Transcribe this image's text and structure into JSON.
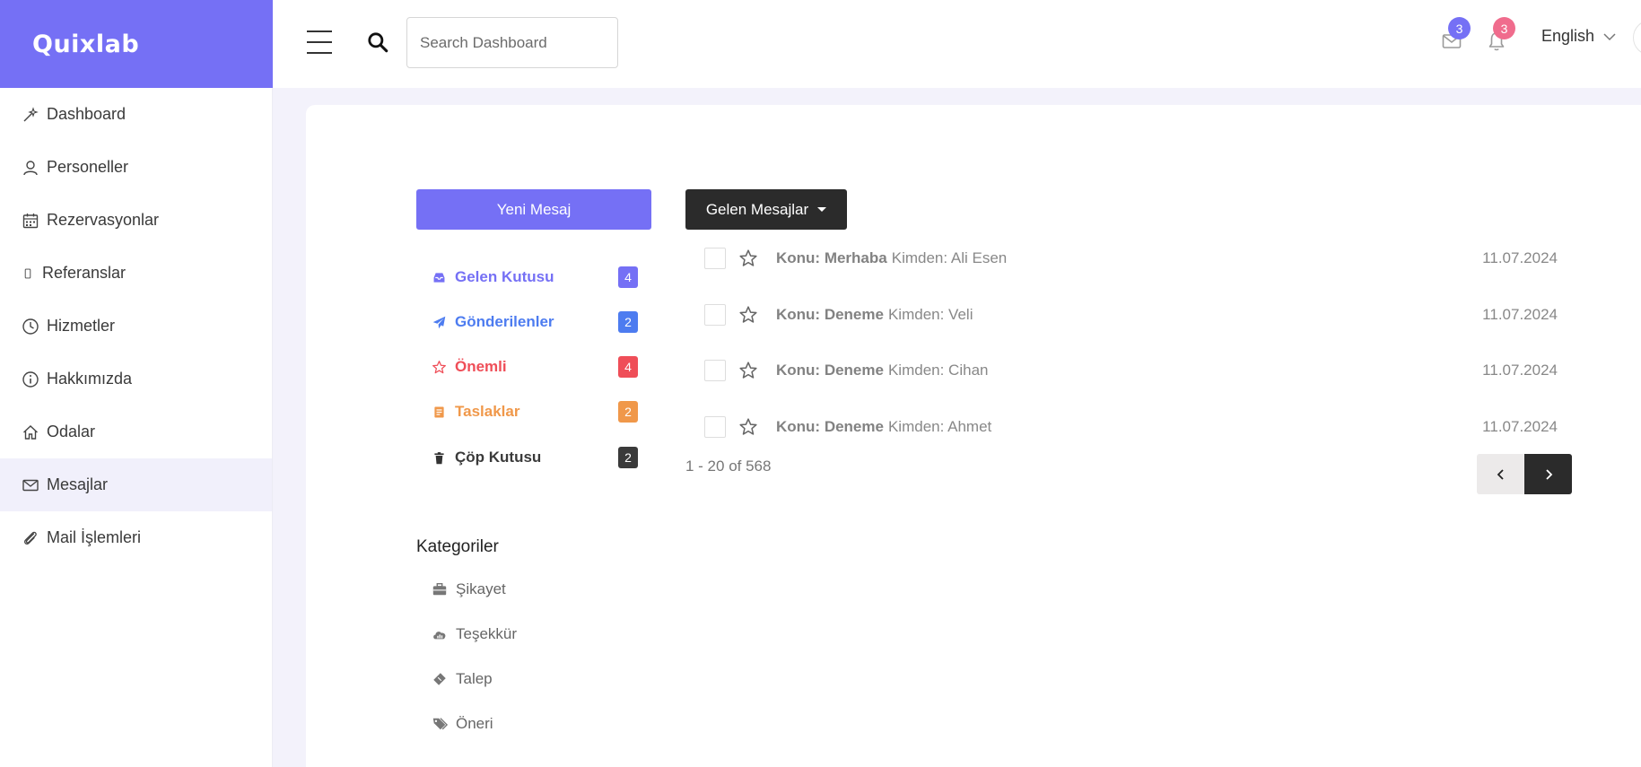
{
  "brand": {
    "name": "Quixlab",
    "color": "#7570f5"
  },
  "sidebar": {
    "items": [
      {
        "label": "Dashboard",
        "icon": "magic-wand-icon"
      },
      {
        "label": "Personeller",
        "icon": "user-icon"
      },
      {
        "label": "Rezervasyonlar",
        "icon": "calendar-icon"
      },
      {
        "label": "Referanslar",
        "icon": "mobile-icon"
      },
      {
        "label": "Hizmetler",
        "icon": "clock-icon"
      },
      {
        "label": "Hakkımızda",
        "icon": "info-icon"
      },
      {
        "label": "Odalar",
        "icon": "home-icon"
      },
      {
        "label": "Mesajlar",
        "icon": "envelope-icon",
        "active": true
      },
      {
        "label": "Mail İşlemleri",
        "icon": "paperclip-icon"
      }
    ]
  },
  "header": {
    "search": {
      "placeholder": "Search Dashboard",
      "value": ""
    },
    "mail_badge": "3",
    "notification_badge": "3",
    "mail_badge_color": "#7570f5",
    "notification_badge_color": "#f06c8d",
    "language": "English"
  },
  "mailbox": {
    "new_message_label": "Yeni Mesaj",
    "folders": [
      {
        "label": "Gelen Kutusu",
        "count": "4",
        "icon": "inbox-icon",
        "color": "#7570f5"
      },
      {
        "label": "Gönderilenler",
        "count": "2",
        "icon": "paper-plane-icon",
        "color": "#4d7cf0"
      },
      {
        "label": "Önemli",
        "count": "4",
        "icon": "star-icon",
        "color": "#ef4e58"
      },
      {
        "label": "Taslaklar",
        "count": "2",
        "icon": "draft-icon",
        "color": "#f0984a"
      },
      {
        "label": "Çöp Kutusu",
        "count": "2",
        "icon": "trash-icon",
        "color": "#3a3a3a"
      }
    ],
    "categories_title": "Kategoriler",
    "categories": [
      {
        "label": "Şikayet",
        "icon": "briefcase-icon"
      },
      {
        "label": "Teşekkür",
        "icon": "cloud-icon"
      },
      {
        "label": "Talep",
        "icon": "ticket-icon"
      },
      {
        "label": "Öneri",
        "icon": "tags-icon"
      }
    ],
    "list_dropdown_label": "Gelen Mesajlar",
    "messages": [
      {
        "subject": "Konu: Merhaba",
        "from": "Kimden: Ali Esen",
        "date": "11.07.2024"
      },
      {
        "subject": "Konu: Deneme",
        "from": "Kimden: Veli",
        "date": "11.07.2024"
      },
      {
        "subject": "Konu: Deneme",
        "from": "Kimden: Cihan",
        "date": "11.07.2024"
      },
      {
        "subject": "Konu: Deneme",
        "from": "Kimden: Ahmet",
        "date": "11.07.2024"
      }
    ],
    "pagination_text": "1 - 20 of 568"
  }
}
